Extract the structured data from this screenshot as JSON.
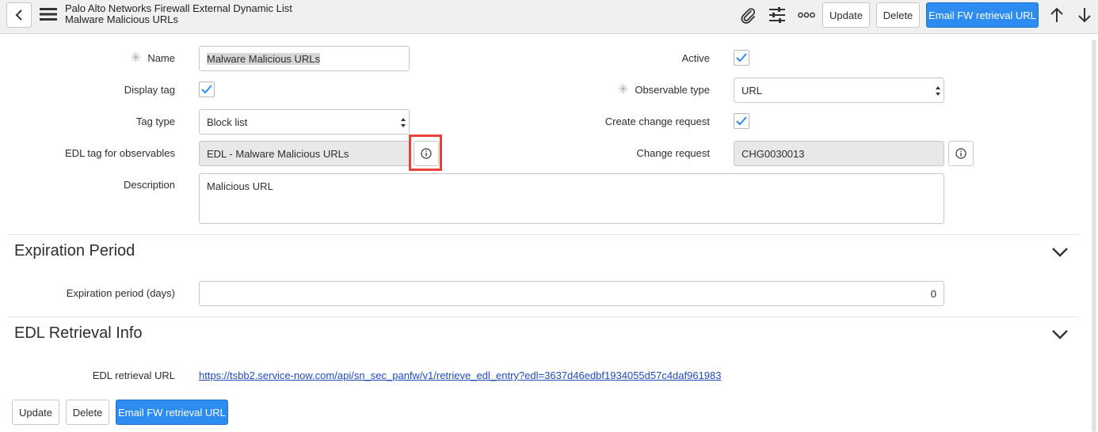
{
  "header": {
    "table_title": "Palo Alto Networks Firewall External Dynamic List",
    "record_title": "Malware Malicious URLs",
    "icons": [
      "back-icon",
      "hamburger-menu-icon",
      "paperclip-icon",
      "sliders-icon",
      "more-options-icon",
      "arrow-up-icon",
      "arrow-down-icon"
    ],
    "update_label": "Update",
    "delete_label": "Delete",
    "email_label": "Email FW retrieval URL"
  },
  "form": {
    "name": {
      "label": "Name",
      "required": true,
      "value": "Malware Malicious URLs"
    },
    "display_tag": {
      "label": "Display tag",
      "checked": true
    },
    "tag_type": {
      "label": "Tag type",
      "value": "Block list"
    },
    "edl_tag": {
      "label": "EDL tag for observables",
      "value": "EDL - Malware Malicious URLs"
    },
    "description": {
      "label": "Description",
      "value": "Malicious URL"
    },
    "active": {
      "label": "Active",
      "checked": true
    },
    "observable_type": {
      "label": "Observable type",
      "required": true,
      "value": "URL"
    },
    "create_change_request": {
      "label": "Create change request",
      "checked": true
    },
    "change_request": {
      "label": "Change request",
      "value": "CHG0030013"
    }
  },
  "expiration_section": {
    "title": "Expiration Period",
    "period_label": "Expiration period (days)",
    "period_value": "0"
  },
  "edl_section": {
    "title": "EDL Retrieval Info",
    "url_label": "EDL retrieval URL",
    "url_value": "https://tsbb2.service-now.com/api/sn_sec_panfw/v1/retrieve_edl_entry?edl=3637d46edbf1934055d57c4daf961983"
  },
  "footer": {
    "update_label": "Update",
    "delete_label": "Delete",
    "email_label": "Email FW retrieval URL"
  },
  "colors": {
    "primary_button": "#2d8cf0",
    "checkmark": "#2d8cf0",
    "highlight_box": "#e8423a",
    "link": "#1f4cbf"
  }
}
